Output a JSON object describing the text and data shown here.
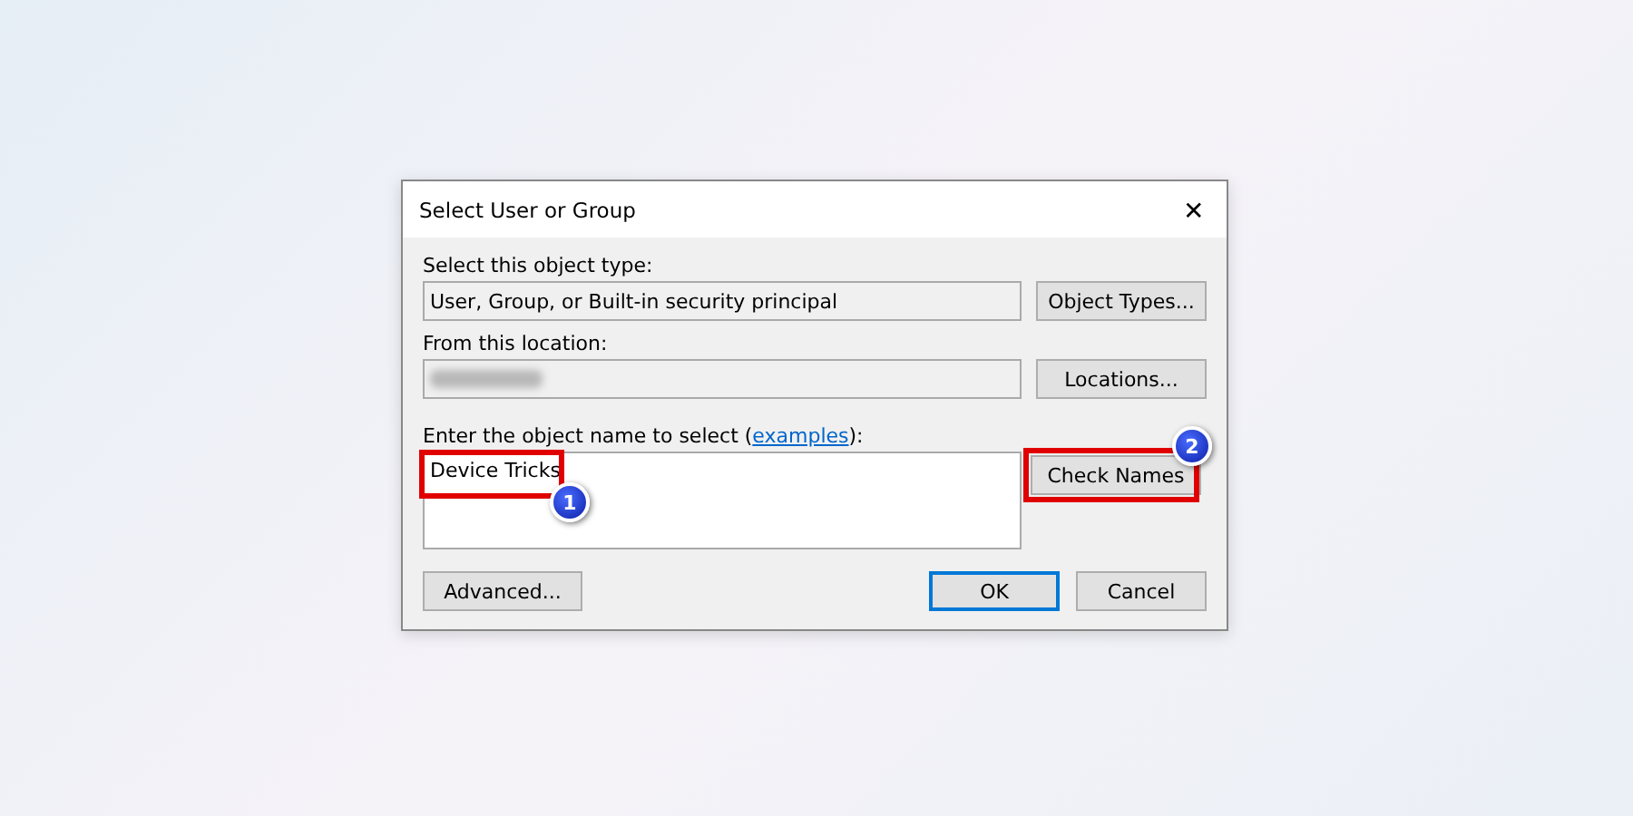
{
  "window": {
    "title": "Select User or Group",
    "close": "✕"
  },
  "object_type": {
    "label": "Select this object type:",
    "value": "User, Group, or Built-in security principal",
    "button": "Object Types..."
  },
  "location": {
    "label": "From this location:",
    "redacted": true,
    "button": "Locations..."
  },
  "object_name": {
    "label_before": "Enter the object name to select (",
    "link": "examples",
    "label_after": "):",
    "value": "Device Tricks",
    "callout": "1"
  },
  "check_button": {
    "label": "Check Names",
    "callout": "2"
  },
  "buttons": [
    {
      "label": "Advanced...",
      "default": false
    },
    {
      "label": "OK",
      "default": true
    },
    {
      "label": "Cancel",
      "default": false
    }
  ]
}
